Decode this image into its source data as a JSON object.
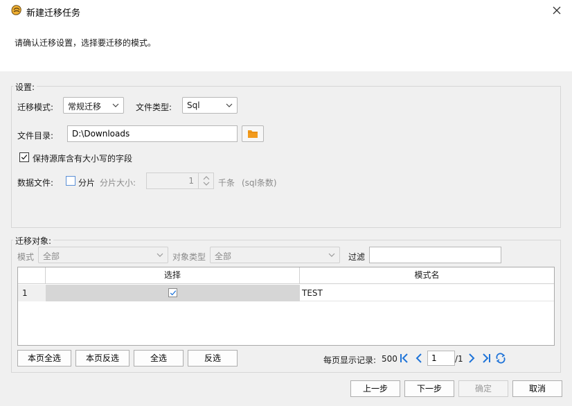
{
  "window": {
    "title": "新建迁移任务"
  },
  "banner": {
    "text": "请确认迁移设置，选择要迁移的模式。"
  },
  "settings": {
    "group_title": "设置:",
    "mode_label": "迁移模式:",
    "mode_value": "常规迁移",
    "filetype_label": "文件类型:",
    "filetype_value": "Sql",
    "dir_label": "文件目录:",
    "dir_value": "D:\\Downloads",
    "keep_case_label": "保持源库含有大小写的字段",
    "keep_case_checked": true,
    "datafile_label": "数据文件:",
    "split_label": "分片",
    "split_checked": false,
    "split_size_label": "分片大小:",
    "split_size_value": "1",
    "unit_label": "千条",
    "unit_note": "(sql条数)"
  },
  "objects": {
    "group_title": "迁移对象:",
    "schema_label": "模式",
    "schema_value": "全部",
    "objtype_label": "对象类型",
    "objtype_value": "全部",
    "filter_label": "过滤",
    "filter_value": "",
    "columns": [
      "选择",
      "模式名"
    ],
    "rows": [
      {
        "index": "1",
        "selected": true,
        "schema": "TEST"
      }
    ]
  },
  "bottom_buttons": {
    "select_page": "本页全选",
    "invert_page": "本页反选",
    "select_all": "全选",
    "invert_all": "反选"
  },
  "pager": {
    "per_page_label": "每页显示记录:",
    "per_page_value": "500",
    "current_page": "1",
    "total_pages": "/1"
  },
  "footer": {
    "prev": "上一步",
    "next": "下一步",
    "ok": "确定",
    "cancel": "取消"
  },
  "colors": {
    "accent": "#1e73d8",
    "folder": "#f29b1d",
    "selected_row": "#d6d6d6"
  }
}
